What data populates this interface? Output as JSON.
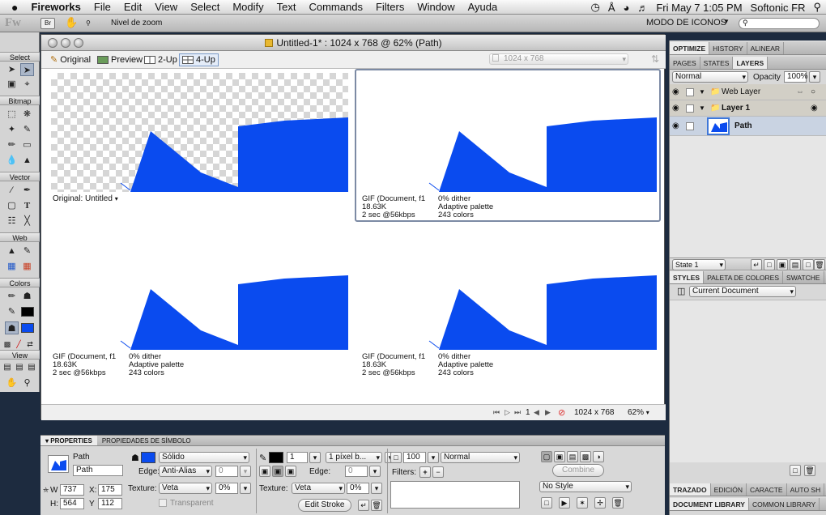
{
  "menubar": {
    "app_name": "Fireworks",
    "items": [
      "File",
      "Edit",
      "View",
      "Select",
      "Modify",
      "Text",
      "Commands",
      "Filters",
      "Window",
      "Ayuda"
    ],
    "clock": "Fri May 7  1:05 PM",
    "user": "Softonic FR"
  },
  "toolbar": {
    "logo": "Fw",
    "br_label": "Br",
    "zoom_label": "Nivel de zoom",
    "mode_label": "MODO DE ICONOS"
  },
  "tools": {
    "sections": [
      "Select",
      "Bitmap",
      "Vector",
      "Web",
      "Colors",
      "View"
    ],
    "text_tool": "T"
  },
  "document": {
    "title": "Untitled-1* : 1024 x 768 @ 62% (Path)",
    "view_buttons": [
      "Original",
      "Preview",
      "2-Up",
      "4-Up"
    ],
    "size_field": "1024 x 768",
    "panes": [
      {
        "label": "Original: Untitled"
      },
      {
        "col1": [
          "GIF (Document, f1",
          "18.63K",
          "2 sec @56kbps"
        ],
        "col2": [
          "0% dither",
          "Adaptive palette",
          "243 colors"
        ]
      },
      {
        "col1": [
          "GIF (Document, f1",
          "18.63K",
          "2 sec @56kbps"
        ],
        "col2": [
          "0% dither",
          "Adaptive palette",
          "243 colors"
        ]
      },
      {
        "col1": [
          "GIF (Document, f1",
          "18.63K",
          "2 sec @56kbps"
        ],
        "col2": [
          "0% dither",
          "Adaptive palette",
          "243 colors"
        ]
      }
    ],
    "status": {
      "frame": "1",
      "size": "1024 x 768",
      "zoom": "62%"
    },
    "fill_color": "#0a4bef"
  },
  "right_panel": {
    "tabs1": [
      "OPTIMIZE",
      "HISTORY",
      "ALINEAR"
    ],
    "tabs2": [
      "PAGES",
      "STATES",
      "LAYERS"
    ],
    "blend": "Normal",
    "opacity_label": "Opacity",
    "opacity": "100%",
    "layers": [
      "Web Layer",
      "Layer 1",
      "Path"
    ],
    "state": "State 1",
    "tabs3": [
      "STYLES",
      "PALETA DE COLORES",
      "SWATCHE"
    ],
    "styles_dropdown": "Current Document",
    "tabs4": [
      "TRAZADO",
      "EDICIÓN",
      "CARACTE",
      "AUTO SH"
    ],
    "tabs5": [
      "DOCUMENT LIBRARY",
      "COMMON LIBRARY"
    ]
  },
  "properties": {
    "tabs": [
      "PROPERTIES",
      "PROPIEDADES DE SÍMBOLO"
    ],
    "object_type": "Path",
    "object_name": "Path",
    "w_label": "W",
    "w": "737",
    "h_label": "H:",
    "h": "564",
    "x_label": "X:",
    "x": "175",
    "y_label": "Y",
    "y": "112",
    "fill_type": "Sólido",
    "edge_label": "Edge:",
    "edge": "Anti-Alias",
    "edge_amount": "0",
    "texture_label": "Texture:",
    "texture": "Veta",
    "texture_pct": "0%",
    "transparent_label": "Transparent",
    "stroke_size": "1",
    "stroke_type": "1 píxel b...",
    "stroke_edge": "0",
    "stroke_texture": "Veta",
    "stroke_texture_pct": "0%",
    "edit_stroke": "Edit Stroke",
    "opacity": "100",
    "blend": "Normal",
    "filters_label": "Filters:",
    "combine": "Combine",
    "style": "No Style"
  }
}
